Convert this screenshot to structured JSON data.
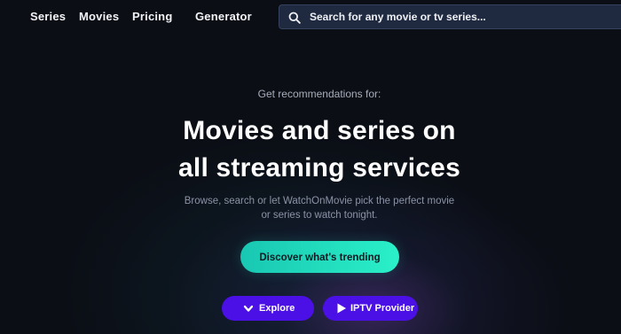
{
  "nav": {
    "items": [
      {
        "label": "Series"
      },
      {
        "label": "Movies"
      },
      {
        "label": "Pricing"
      },
      {
        "label": "Generator"
      }
    ]
  },
  "search": {
    "placeholder": "Search for any movie or tv series...",
    "value": "",
    "icon": "search-icon"
  },
  "hero": {
    "eyebrow": "Get recommendations for:",
    "headline_line1": "Movies and series on",
    "headline_line2": "all streaming services",
    "subtext_line1": "Browse, search or let WatchOnMovie pick the perfect movie",
    "subtext_line2": "or series to watch tonight.",
    "cta_label": "Discover what's trending"
  },
  "actions": {
    "explore_label": "Explore",
    "explore_icon": "chevron-down-icon",
    "iptv_label": "IPTV Provider",
    "iptv_icon": "play-icon"
  },
  "colors": {
    "background": "#0b0e15",
    "accent_teal": "#2af0c8",
    "accent_purple": "#4a10e6",
    "search_bg": "#1f2a40"
  }
}
